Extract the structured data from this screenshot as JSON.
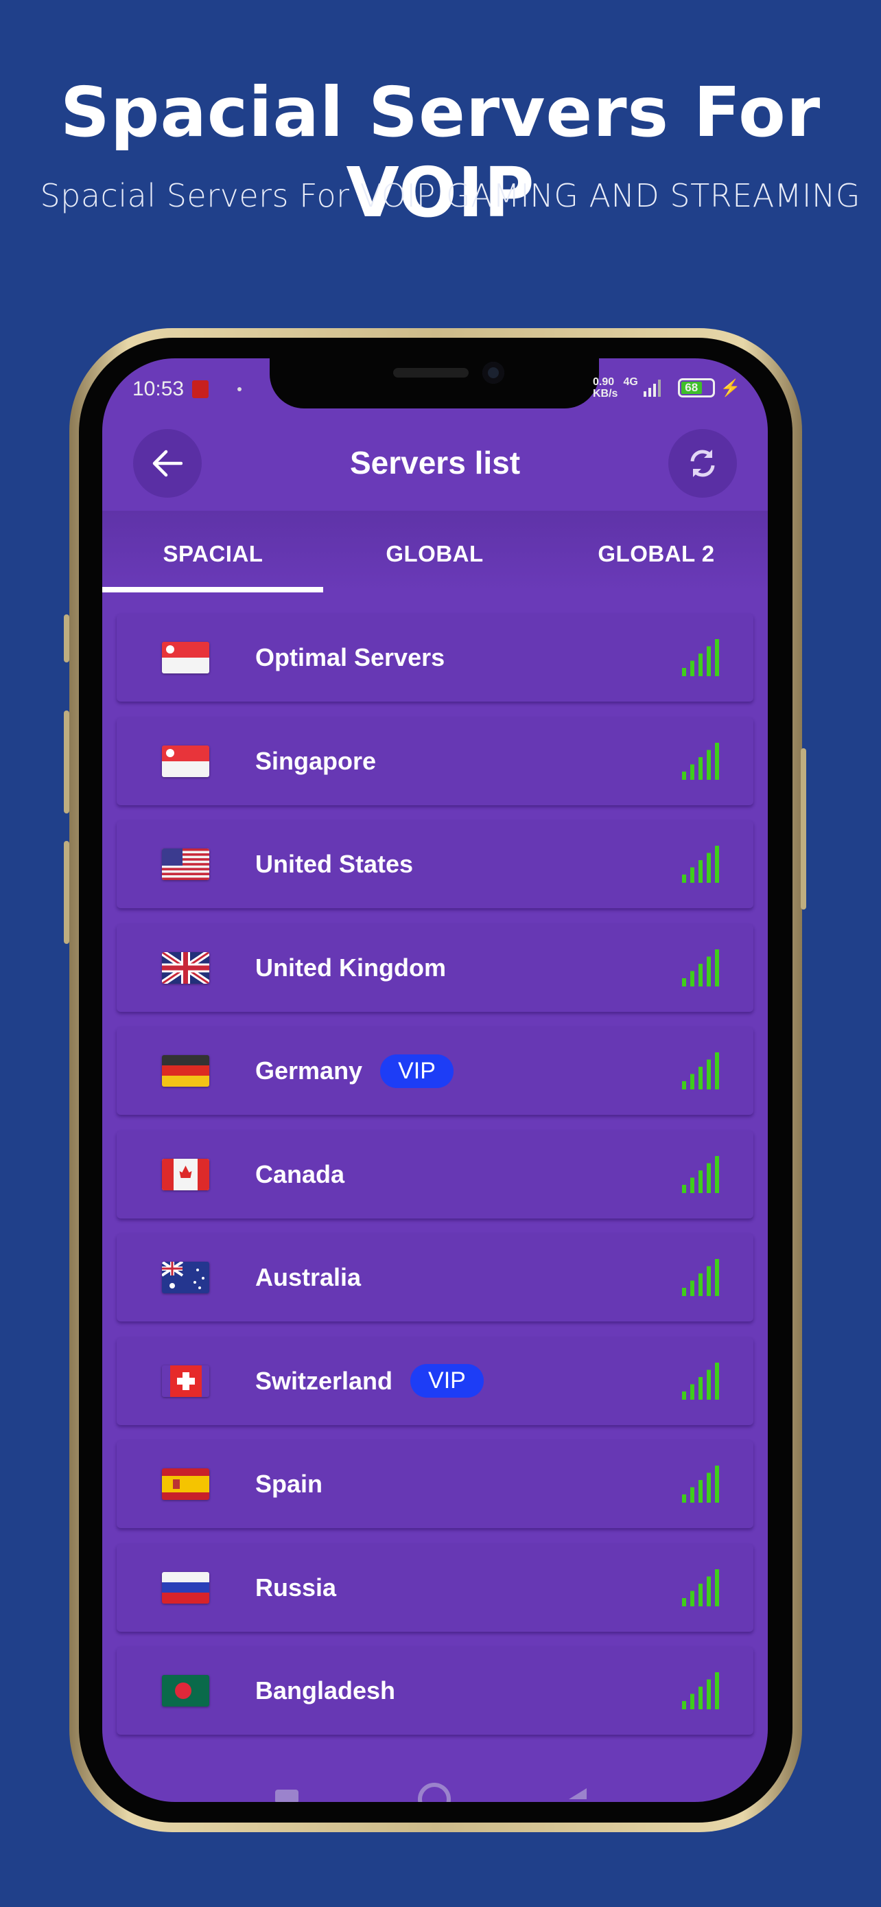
{
  "promo": {
    "title": "Spacial Servers For VOIP",
    "subtitle": "Spacial Servers  For VOIP GAMING AND STREAMING"
  },
  "status_bar": {
    "time": "10:53",
    "net_speed": "0.90",
    "net_unit": "KB/s",
    "network": "4G",
    "battery": "68"
  },
  "toolbar": {
    "title": "Servers list",
    "back_icon": "arrow-left-icon",
    "refresh_icon": "refresh-icon"
  },
  "tabs": [
    {
      "label": "SPACIAL",
      "active": true
    },
    {
      "label": "GLOBAL",
      "active": false
    },
    {
      "label": "GLOBAL 2",
      "active": false
    }
  ],
  "colors": {
    "background": "#20408a",
    "screen": "#6a3ab8",
    "vip_badge": "#1d3df6",
    "signal": "#3fcf1a"
  },
  "servers": [
    {
      "name": "Optimal Servers",
      "flag": "sg",
      "vip": ""
    },
    {
      "name": "Singapore",
      "flag": "sg",
      "vip": ""
    },
    {
      "name": "United States",
      "flag": "us",
      "vip": ""
    },
    {
      "name": "United Kingdom",
      "flag": "gb",
      "vip": ""
    },
    {
      "name": "Germany",
      "flag": "de",
      "vip": "VIP"
    },
    {
      "name": "Canada",
      "flag": "ca",
      "vip": ""
    },
    {
      "name": "Australia",
      "flag": "au",
      "vip": ""
    },
    {
      "name": "Switzerland",
      "flag": "ch",
      "vip": "VIP"
    },
    {
      "name": "Spain",
      "flag": "es",
      "vip": ""
    },
    {
      "name": "Russia",
      "flag": "ru",
      "vip": ""
    },
    {
      "name": "Bangladesh",
      "flag": "bd",
      "vip": ""
    }
  ]
}
